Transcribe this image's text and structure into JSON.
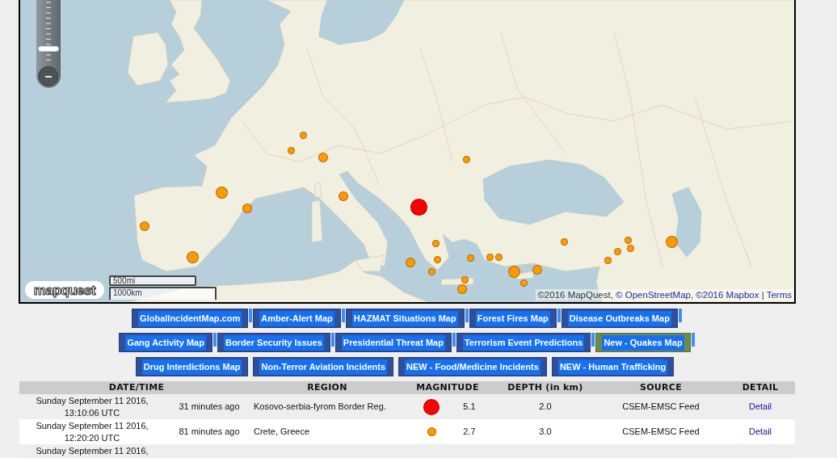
{
  "map": {
    "zoom_slider": {
      "level": 0.2
    },
    "markers": [
      {
        "color": "#ff9900",
        "kind": "small"
      },
      {
        "color": "#ff9900",
        "kind": "small"
      },
      {
        "color": "#ff9900",
        "kind": "medium"
      },
      {
        "color": "#ff9900",
        "kind": "small"
      },
      {
        "color": "#ff9900",
        "kind": "medium"
      },
      {
        "color": "#ff9900",
        "kind": "large"
      },
      {
        "color": "#ff0000",
        "kind": "major"
      },
      {
        "color": "#ff9900",
        "kind": "medium"
      },
      {
        "color": "#ff9900",
        "kind": "medium"
      },
      {
        "color": "#ff9900",
        "kind": "small"
      },
      {
        "color": "#ff9900",
        "kind": "small"
      },
      {
        "color": "#ff9900",
        "kind": "large"
      },
      {
        "color": "#ff9900",
        "kind": "small"
      },
      {
        "color": "#ff9900",
        "kind": "small"
      },
      {
        "color": "#ff9900",
        "kind": "small"
      },
      {
        "color": "#ff9900",
        "kind": "large"
      },
      {
        "color": "#ff9900",
        "kind": "small"
      },
      {
        "color": "#ff9900",
        "kind": "small"
      },
      {
        "color": "#ff9900",
        "kind": "small"
      },
      {
        "color": "#ff9900",
        "kind": "small"
      },
      {
        "color": "#ff9900",
        "kind": "medium"
      },
      {
        "color": "#ff9900",
        "kind": "small"
      },
      {
        "color": "#ff9900",
        "kind": "medium"
      },
      {
        "color": "#ff9900",
        "kind": "large"
      },
      {
        "color": "#ff9900",
        "kind": "small"
      },
      {
        "color": "#ff9900",
        "kind": "small"
      },
      {
        "color": "#ff9900",
        "kind": "small"
      },
      {
        "color": "#ff9900",
        "kind": "medium"
      }
    ],
    "scale": [
      "500mi",
      "1000km"
    ],
    "logo": "mapquest",
    "attribution": [
      {
        "kind": "text",
        "text": "©2016 MapQuest, "
      },
      {
        "kind": "link",
        "text": "© OpenStreetMap"
      },
      {
        "kind": "text",
        "text": ", "
      },
      {
        "kind": "link",
        "text": "©2016 Mapbox"
      },
      {
        "kind": "text",
        "text": " | "
      },
      {
        "kind": "link",
        "text": "Terms"
      }
    ]
  },
  "nav_rows": [
    {
      "kind": "bars",
      "links": [
        {
          "label": "GlobalIncidentMap.com",
          "selected": false
        },
        {
          "label": "Amber-Alert Map",
          "selected": false
        },
        {
          "label": "HAZMAT Situations Map",
          "selected": false
        },
        {
          "label": "Forest Fires Map",
          "selected": false
        },
        {
          "label": "Disease Outbreaks Map",
          "selected": false
        }
      ]
    },
    {
      "kind": "bars",
      "links": [
        {
          "label": "Gang Activity Map",
          "selected": false
        },
        {
          "label": "Border Security Issues",
          "selected": false
        },
        {
          "label": "Presidential Threat Map",
          "selected": false
        },
        {
          "label": "Terrorism Event Predictions",
          "selected": false
        },
        {
          "label": "New - Quakes Map",
          "selected": true
        }
      ]
    },
    {
      "kind": "plain",
      "links": [
        {
          "label": "Drug Interdictions Map",
          "selected": false
        },
        {
          "label": "Non-Terror Aviation Incidents",
          "selected": false
        },
        {
          "label": "NEW - Food/Medicine Incidents",
          "selected": false
        },
        {
          "label": "NEW - Human Trafficking",
          "selected": false
        }
      ]
    }
  ],
  "table": {
    "columns": [
      "DATE/TIME",
      "REGION",
      "MAGNITUDE",
      "DEPTH (in km)",
      "SOURCE",
      "DETAIL"
    ],
    "rows": [
      {
        "date_time": "Sunday September 11 2016, 13:10:06 UTC",
        "age": "31 minutes ago",
        "region": "Kosovo-serbia-fyrom Border Reg.",
        "marker": {
          "color": "#ff0000",
          "kind": "large"
        },
        "magnitude": "5.1",
        "depth": "2.0",
        "source": "CSEM-EMSC Feed",
        "detail": "Detail"
      },
      {
        "date_time": "Sunday September 11 2016, 12:20:20 UTC",
        "age": "81 minutes ago",
        "region": "Crete, Greece",
        "marker": {
          "color": "#ff9900",
          "kind": "small"
        },
        "magnitude": "2.7",
        "depth": "3.0",
        "source": "CSEM-EMSC Feed",
        "detail": "Detail"
      },
      {
        "date_time": "Sunday September 11 2016,"
      }
    ]
  }
}
